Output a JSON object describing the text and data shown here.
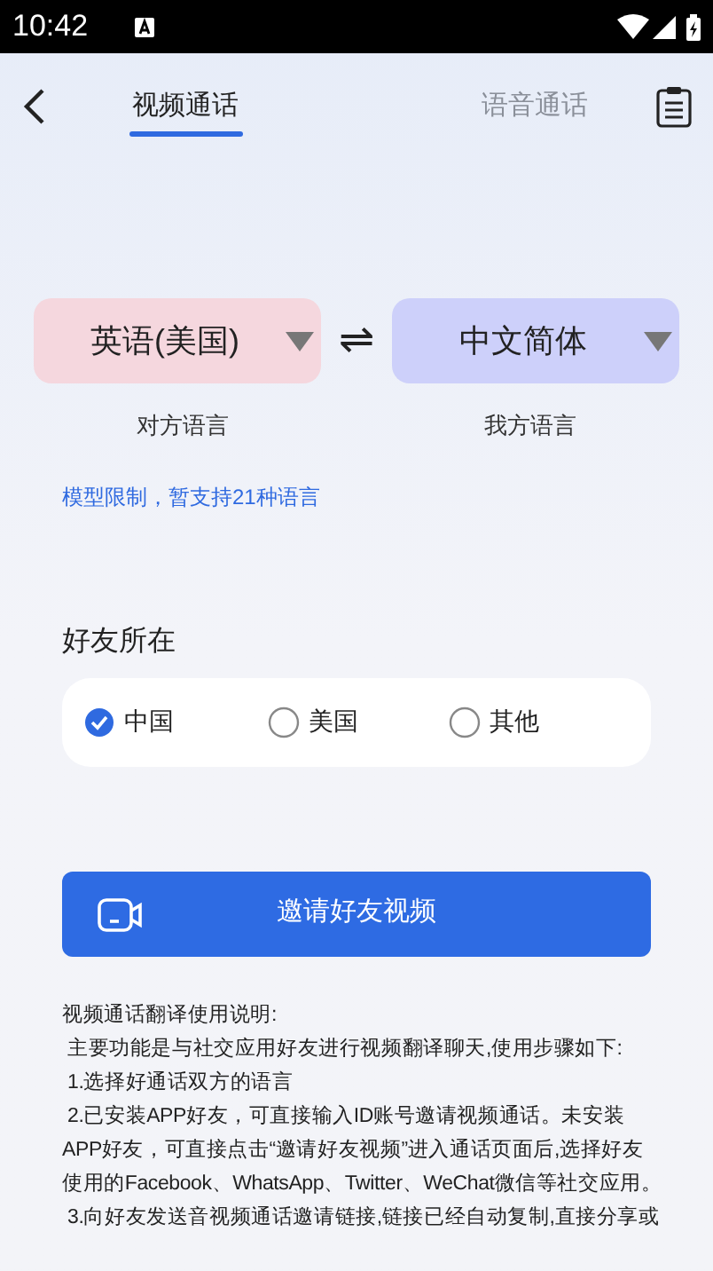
{
  "status_bar": {
    "time": "10:42"
  },
  "tabs": [
    {
      "label": "视频通话",
      "selected": true
    },
    {
      "label": "语音通话",
      "selected": false
    }
  ],
  "languages": [
    {
      "value": "英语(美国)",
      "label": "对方语言",
      "color": "#f5d7de"
    },
    {
      "value": "中文简体",
      "label": "我方语言",
      "color": "#cdd0fa"
    }
  ],
  "swap": "⇌",
  "note": "模型限制，暂支持21种语言",
  "location": {
    "title": "好友所在",
    "options": [
      {
        "label": "中国",
        "selected": true
      },
      {
        "label": "美国",
        "selected": false
      },
      {
        "label": "其他",
        "selected": false
      }
    ]
  },
  "invite_button": "邀请好友视频",
  "instructions": [
    "视频通话翻译使用说明:",
    " 主要功能是与社交应用好友进行视频翻译聊天,使用步骤如下:",
    " 1.选择好通话双方的语言",
    " 2.已安装APP好友，可直接输入ID账号邀请视频通话。未安装APP好友，可直接点击“邀请好友视频”进入通话页面后,选择好友使用的Facebook、WhatsApp、Twitter、WeChat微信等社交应用。",
    " 3.向好友发送音视频通话邀请链接,链接已经自动复制,直接分享或"
  ]
}
